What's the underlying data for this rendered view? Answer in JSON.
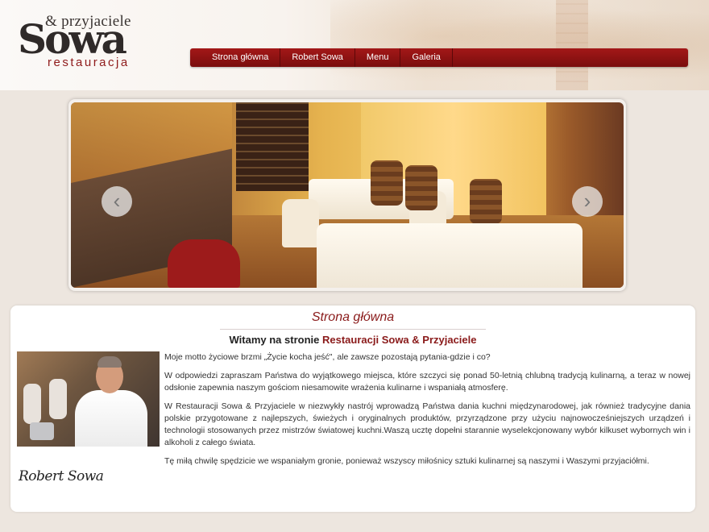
{
  "brand": {
    "top": "& przyjaciele",
    "main": "Sowa",
    "bottom": "restauracja"
  },
  "nav": {
    "items": [
      "Strona główna",
      "Robert Sowa",
      "Menu",
      "Galeria"
    ]
  },
  "slider": {
    "prev_icon": "chevron-left-icon",
    "next_icon": "chevron-right-icon"
  },
  "content": {
    "title": "Strona główna",
    "welcome_prefix": "Witamy na stronie",
    "welcome_accent": "Restauracji Sowa & Przyjaciele",
    "paragraphs": [
      "Moje motto życiowe brzmi „Życie kocha jeść\", ale zawsze pozostają pytania-gdzie i co?",
      "W odpowiedzi zapraszam Państwa do wyjątkowego miejsca, które szczyci się ponad 50-letnią chlubną tradycją kulinarną, a teraz w nowej odsłonie zapewnia naszym gościom niesamowite wrażenia kulinarne i wspaniałą atmosferę.",
      "W Restauracji Sowa & Przyjaciele w niezwykły nastrój wprowadzą Państwa dania kuchni międzynarodowej, jak również tradycyjne dania polskie przygotowane z najlepszych, świeżych i oryginalnych produktów, przyrządzone przy użyciu najnowocześniejszych urządzeń i technologii stosowanych przez mistrzów światowej kuchni.Waszą ucztę dopełni starannie wyselekcjonowany wybór kilkuset wybornych win i alkoholi z całego świata.",
      "Tę miłą chwilę spędzicie we wspaniałym gronie, ponieważ wszyscy miłośnicy sztuki kulinarnej są naszymi i Waszymi przyjaciółmi."
    ],
    "signature": "Robert Sowa"
  }
}
